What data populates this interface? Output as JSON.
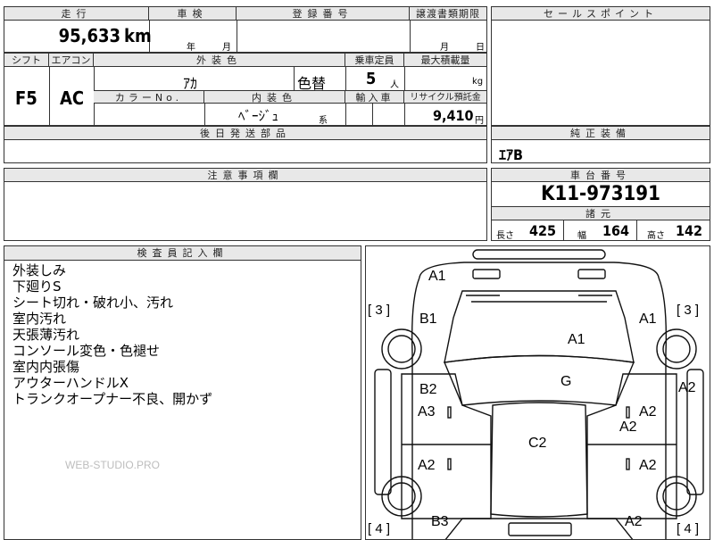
{
  "top_header": {
    "mileage_label": "走行",
    "inspection_label": "車検",
    "registration_label": "登録番号",
    "transfer_deadline_label": "譲渡書類期限",
    "sales_point_label": "セールスポイント"
  },
  "top_values": {
    "mileage": "95,633",
    "mileage_unit": "km",
    "inspection_year_label": "年",
    "inspection_month_label": "月",
    "transfer_month_label": "月",
    "transfer_day_label": "日"
  },
  "row2_header": {
    "shift_label": "シフト",
    "aircon_label": "エアコン",
    "exterior_color_label": "外装色",
    "capacity_label": "乗車定員",
    "max_load_label": "最大積載量"
  },
  "row2_values": {
    "shift": "F5",
    "aircon": "AC",
    "exterior_color": "ｱｶ",
    "color_change": "色替",
    "capacity": "5",
    "capacity_unit": "人",
    "load_unit": "kg"
  },
  "row3_header": {
    "color_no_label": "カラーNo.",
    "interior_color_label": "内装色",
    "import_label": "輸入車",
    "recycle_label": "リサイクル預託金"
  },
  "row3_values": {
    "interior_color": "ﾍﾞｰｼﾞｭ",
    "interior_suffix": "系",
    "recycle_amount": "9,410",
    "recycle_unit": "円"
  },
  "parts_section": {
    "label": "後日発送部品"
  },
  "equipment_section": {
    "label": "純正装備",
    "value": "ｴｱB"
  },
  "caution_section": {
    "label": "注意事項欄"
  },
  "chassis_section": {
    "label": "車台番号",
    "number": "K11-973191",
    "specs_label": "諸元",
    "length_label": "長さ",
    "length_value": "425",
    "width_label": "幅",
    "width_value": "164",
    "height_label": "高さ",
    "height_value": "142"
  },
  "inspector_section": {
    "label": "検査員記入欄",
    "notes": [
      "外装しみ",
      "下廻りS",
      "シート切れ・破れ小、汚れ",
      "室内汚れ",
      "天張薄汚れ",
      "コンソール変色・色褪せ",
      "室内内張傷",
      "アウターハンドルX",
      "トランクオープナー不良、開かず"
    ],
    "watermark": "WEB-STUDIO.PRO"
  },
  "diagram": {
    "marks": {
      "front_bumper": "A1",
      "hood": "A1",
      "left_front_fender": "B1",
      "right_front_fender": "A1",
      "bracket_left_top": "[ 3 ]",
      "bracket_right_top": "[ 3 ]",
      "roof_front": "G",
      "left_front_door_upper": "B2",
      "left_front_door": "A3",
      "right_front_door": "A2",
      "right_front_door2": "A2",
      "right_side_rocker": "A2",
      "roof": "C2",
      "left_rear_door": "A2",
      "right_rear_door": "A2",
      "left_rear_fender": "B3",
      "right_rear_fender": "A2",
      "bracket_left_bottom": "[ 4 ]",
      "bracket_right_bottom": "[ 4 ]"
    }
  }
}
